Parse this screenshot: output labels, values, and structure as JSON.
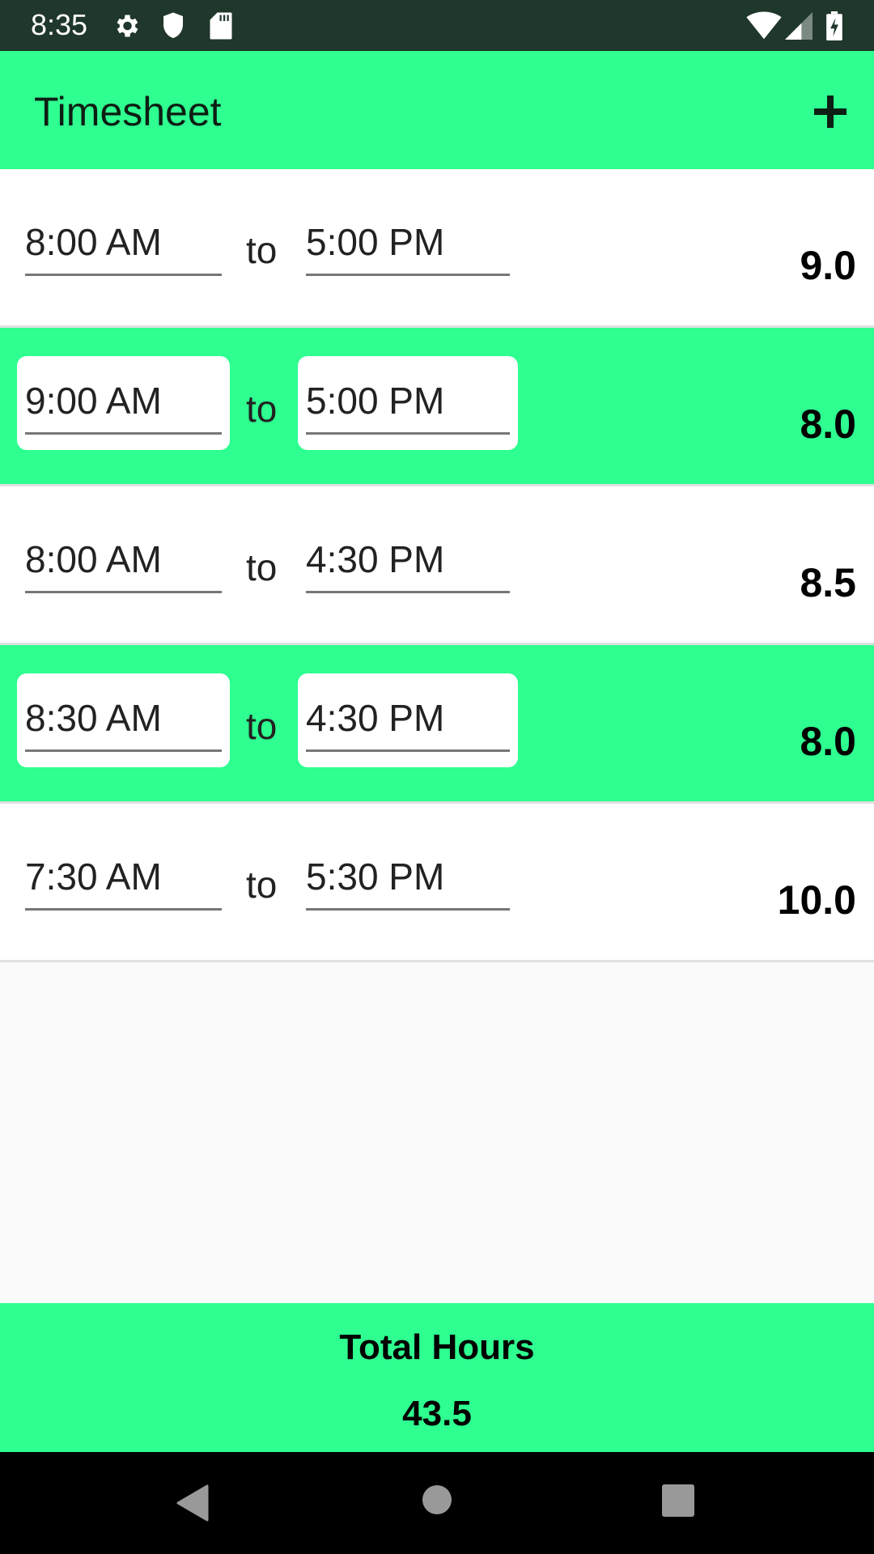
{
  "status_bar": {
    "time": "8:35",
    "left_icons": [
      "gear-icon",
      "shield-icon",
      "sd-card-icon"
    ],
    "right_icons": [
      "wifi-icon",
      "signal-icon",
      "battery-charging-icon"
    ]
  },
  "app_bar": {
    "title": "Timesheet",
    "add_icon": "+"
  },
  "entries": [
    {
      "start": "8:00 AM",
      "separator": "to",
      "end": "5:00 PM",
      "hours": "9.0",
      "highlighted": false
    },
    {
      "start": "9:00 AM",
      "separator": "to",
      "end": "5:00 PM",
      "hours": "8.0",
      "highlighted": true
    },
    {
      "start": "8:00 AM",
      "separator": "to",
      "end": "4:30 PM",
      "hours": "8.5",
      "highlighted": false
    },
    {
      "start": "8:30 AM",
      "separator": "to",
      "end": "4:30 PM",
      "hours": "8.0",
      "highlighted": true
    },
    {
      "start": "7:30 AM",
      "separator": "to",
      "end": "5:30 PM",
      "hours": "10.0",
      "highlighted": false
    }
  ],
  "footer": {
    "label": "Total Hours",
    "value": "43.5"
  },
  "colors": {
    "accent": "#2eff90",
    "status_bar": "#20372b"
  }
}
